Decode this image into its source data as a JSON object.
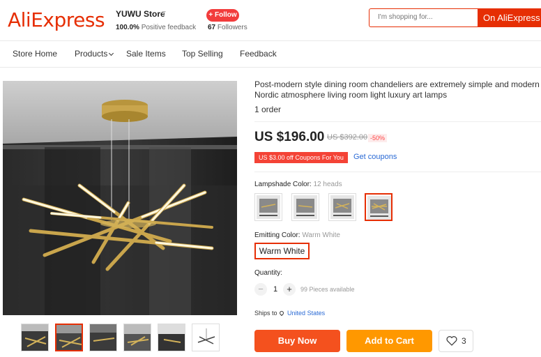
{
  "header": {
    "logo": "AliExpress",
    "store_name": "YUWU Store",
    "feedback_pct": "100.0%",
    "feedback_label": "Positive feedback",
    "follow_label": "+ Follow",
    "followers_count": "67",
    "followers_label": "Followers",
    "search_placeholder": "I'm shopping for...",
    "search_button": "On AliExpress"
  },
  "nav": {
    "items": [
      "Store Home",
      "Products",
      "Sale Items",
      "Top Selling",
      "Feedback"
    ]
  },
  "product": {
    "title": "Post-modern style dining room chandeliers are extremely simple and modern Nordic atmosphere living room light luxury art lamps",
    "orders": "1 order",
    "price": "US $196.00",
    "old_price": "US $392.00",
    "discount": "-50%",
    "coupon_badge": "US $3.00 off Coupons For You",
    "coupon_link": "Get coupons",
    "lampshade_label": "Lampshade Color:",
    "lampshade_value": "12 heads",
    "emitting_label": "Emitting Color:",
    "emitting_value": "Warm White",
    "emitting_option": "Warm White",
    "quantity_label": "Quantity:",
    "quantity_minus": "−",
    "quantity_plus": "+",
    "quantity_value": "1",
    "available": "99 Pieces available",
    "ships_to_label": "Ships to",
    "ships_to_location": "United States",
    "buy_now": "Buy Now",
    "add_to_cart": "Add to Cart",
    "wishlist_count": "3"
  },
  "colors": {
    "brand": "#e62e04",
    "buy": "#f4511e",
    "cart": "#ff9800",
    "link": "#2a6ad5"
  }
}
